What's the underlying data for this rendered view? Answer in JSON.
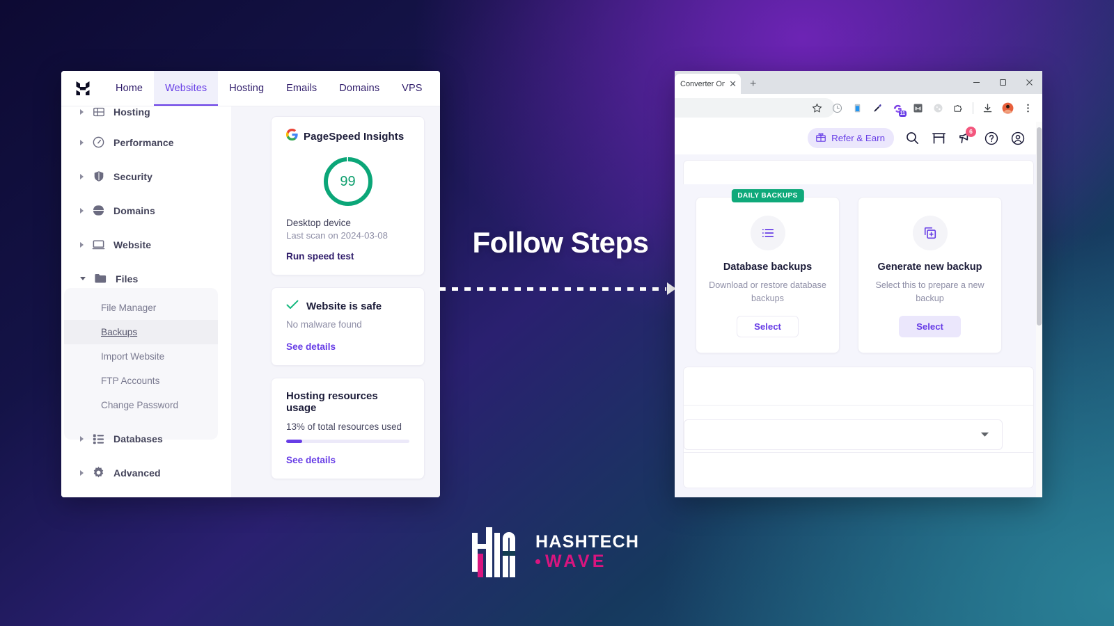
{
  "hpanel": {
    "logo_icon": "hostinger-h-logo-icon",
    "nav": [
      {
        "label": "Home",
        "active": false
      },
      {
        "label": "Websites",
        "active": true
      },
      {
        "label": "Hosting",
        "active": false
      },
      {
        "label": "Emails",
        "active": false
      },
      {
        "label": "Domains",
        "active": false
      },
      {
        "label": "VPS",
        "active": false
      }
    ],
    "sidebar": {
      "items": [
        {
          "label": "Hosting",
          "icon": "server-icon",
          "expanded": false
        },
        {
          "label": "Performance",
          "icon": "speedometer-icon",
          "expanded": false
        },
        {
          "label": "Security",
          "icon": "shield-icon",
          "expanded": false
        },
        {
          "label": "Domains",
          "icon": "globe-icon",
          "expanded": false
        },
        {
          "label": "Website",
          "icon": "monitor-icon",
          "expanded": false
        },
        {
          "label": "Files",
          "icon": "folder-icon",
          "expanded": true
        },
        {
          "label": "Databases",
          "icon": "database-list-icon",
          "expanded": false
        },
        {
          "label": "Advanced",
          "icon": "gear-icon",
          "expanded": false
        }
      ],
      "files_children": [
        {
          "label": "File Manager",
          "selected": false
        },
        {
          "label": "Backups",
          "selected": true
        },
        {
          "label": "Import Website",
          "selected": false
        },
        {
          "label": "FTP Accounts",
          "selected": false
        },
        {
          "label": "Change Password",
          "selected": false
        }
      ]
    },
    "pagespeed": {
      "icon": "google-g-icon",
      "title": "PageSpeed Insights",
      "score": "99",
      "score_max": 100,
      "gauge_color": "#0ba678",
      "device": "Desktop device",
      "last_scan": "Last scan on 2024-03-08",
      "action": "Run speed test"
    },
    "safety": {
      "icon": "check-icon",
      "title": "Website is safe",
      "subtitle": "No malware found",
      "link": "See details",
      "check_color": "#16b97f"
    },
    "resources": {
      "title": "Hosting resources usage",
      "subtitle": "13% of total resources used",
      "percent": 13,
      "bar_color": "#673de6",
      "link": "See details"
    }
  },
  "overlay": {
    "heading": "Follow Steps",
    "arrow_icon": "dotted-arrow-right-icon"
  },
  "browser": {
    "tab": {
      "title": "Converter On",
      "close_icon": "close-icon"
    },
    "new_tab_icon": "plus-icon",
    "window_controls": [
      {
        "name": "minimize-icon",
        "glyph": "–"
      },
      {
        "name": "maximize-icon",
        "glyph": "❐"
      },
      {
        "name": "close-window-icon",
        "glyph": "✕"
      }
    ],
    "toolbar_icons": [
      {
        "name": "bookmark-star-icon"
      },
      {
        "name": "clock-history-icon"
      },
      {
        "name": "clipboard-extension-icon"
      },
      {
        "name": "eyedropper-extension-icon"
      },
      {
        "name": "grammarly-extension-icon",
        "badge": "11"
      },
      {
        "name": "mailtrack-extension-icon"
      },
      {
        "name": "disabled-extension-icon"
      },
      {
        "name": "extensions-puzzle-icon"
      },
      {
        "name": "downloads-icon"
      },
      {
        "name": "profile-avatar-icon"
      },
      {
        "name": "browser-menu-icon"
      }
    ]
  },
  "panel_page": {
    "header": {
      "refer_label": "Refer & Earn",
      "refer_icon": "gift-icon",
      "icons": [
        {
          "name": "search-icon"
        },
        {
          "name": "marketplace-store-icon"
        },
        {
          "name": "announcements-megaphone-icon",
          "badge": "6"
        },
        {
          "name": "help-question-icon"
        },
        {
          "name": "account-avatar-icon"
        }
      ]
    },
    "backup_cards": [
      {
        "badge": "DAILY BACKUPS",
        "icon": "list-lines-icon",
        "title": "Database backups",
        "description": "Download or restore database backups",
        "button": "Select",
        "button_style": "outline"
      },
      {
        "badge": null,
        "icon": "copy-plus-icon",
        "title": "Generate new backup",
        "description": "Select this to prepare a new backup",
        "button": "Select",
        "button_style": "filled"
      }
    ],
    "select_field": {
      "value": "",
      "chevron_icon": "chevron-down-icon"
    }
  },
  "brand": {
    "mark_icon": "hashtech-wave-mark-icon",
    "line1": "HASHTECH",
    "line2": "WAVE",
    "accent_color": "#d9157f"
  }
}
